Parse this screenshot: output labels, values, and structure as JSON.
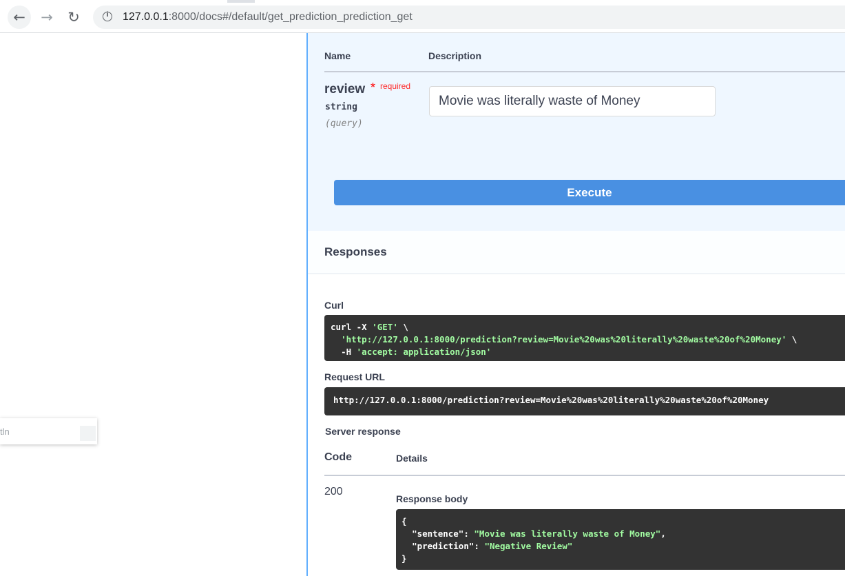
{
  "browser": {
    "url_host": "127.0.0.1",
    "url_rest": ":8000/docs#/default/get_prediction_prediction_get",
    "back_glyph": "←",
    "forward_glyph": "→",
    "reload_glyph": "↻"
  },
  "popup": {
    "text": "tln"
  },
  "parameters": {
    "col_name": "Name",
    "col_description": "Description",
    "param": {
      "name": "review",
      "star": "*",
      "required": "required",
      "type": "string",
      "in": "(query)",
      "value": "Movie was literally waste of Money"
    },
    "execute_label": "Execute"
  },
  "responses": {
    "title": "Responses",
    "curl_label": "Curl",
    "curl": {
      "line1_cmd": "curl -X ",
      "line1_method": "'GET'",
      "line1_cont": " \\",
      "line2_url": "'http://127.0.0.1:8000/prediction?review=Movie%20was%20literally%20waste%20of%20Money'",
      "line2_cont": " \\",
      "line3_flag": "-H ",
      "line3_header": "'accept: application/json'"
    },
    "request_url_label": "Request URL",
    "request_url": "http://127.0.0.1:8000/prediction?review=Movie%20was%20literally%20waste%20of%20Money",
    "server_response_label": "Server response",
    "code_header": "Code",
    "details_header": "Details",
    "code": "200",
    "response_body_label": "Response body",
    "body": {
      "open": "{",
      "key1": "\"sentence\"",
      "val1": "\"Movie was literally waste of Money\"",
      "key2": "\"prediction\"",
      "val2": "\"Negative Review\"",
      "close": "}"
    }
  },
  "colors": {
    "accent": "#61affe",
    "execute": "#4990e2",
    "code_bg": "#333333",
    "string": "#a2fca2",
    "required": "#ff0000"
  }
}
